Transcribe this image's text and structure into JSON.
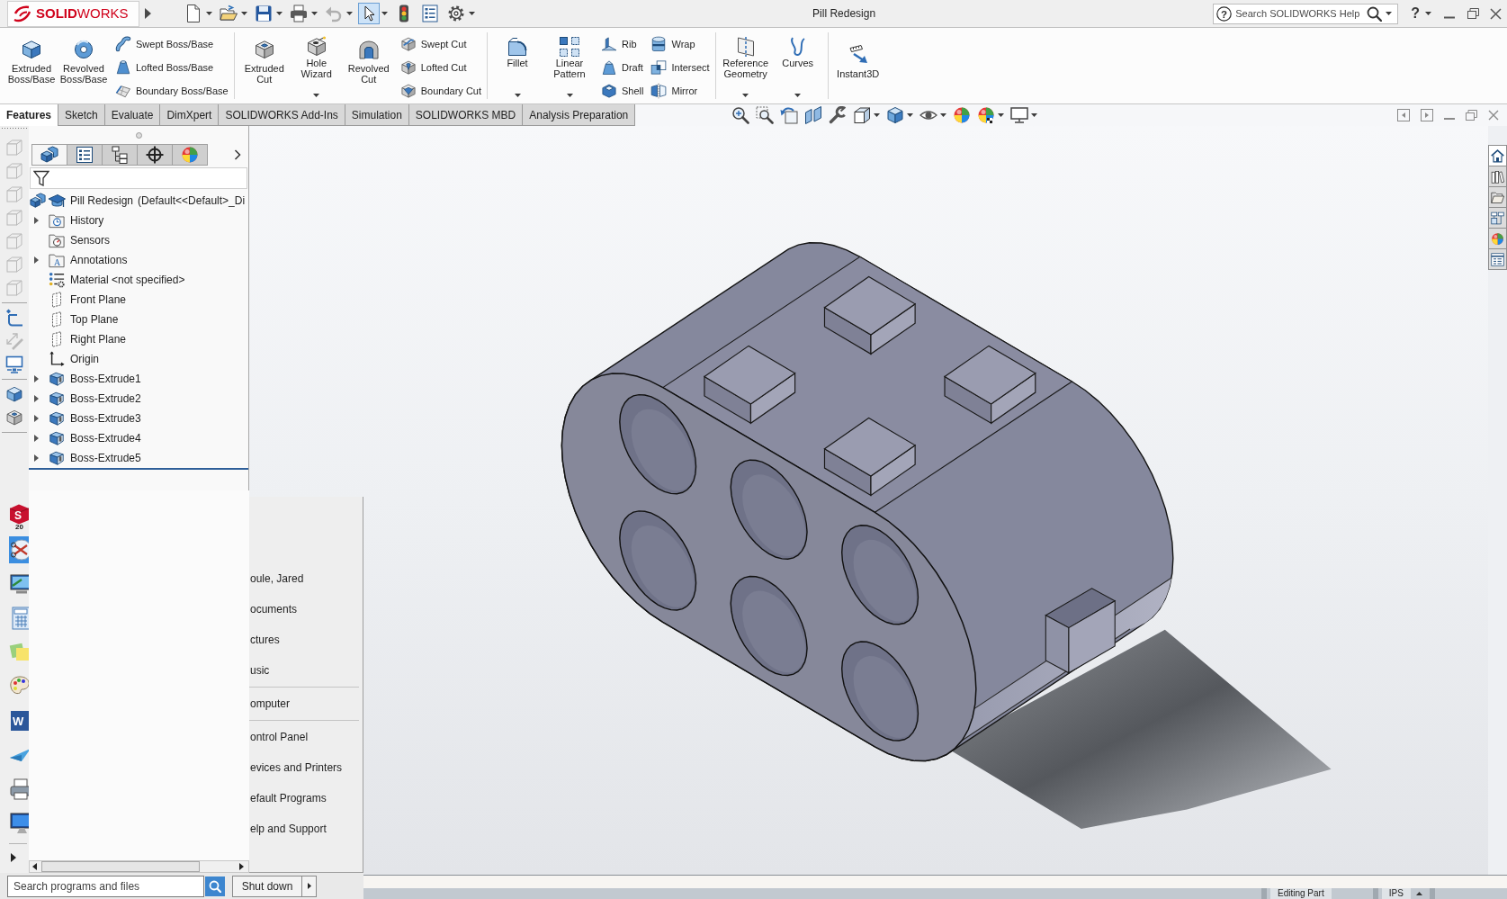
{
  "title_bar": {
    "logo": "**SOLID**WORKS",
    "quick_access": [
      {
        "kind": "new",
        "dropdown": true,
        "disabled": false,
        "pressed": false
      },
      {
        "kind": "open",
        "dropdown": true,
        "disabled": false,
        "pressed": false
      },
      {
        "kind": "save",
        "dropdown": true,
        "disabled": false,
        "pressed": false
      },
      {
        "kind": "print",
        "dropdown": true,
        "disabled": false,
        "pressed": false
      },
      {
        "kind": "undo",
        "dropdown": true,
        "disabled": true,
        "pressed": false
      },
      {
        "kind": "select",
        "dropdown": true,
        "disabled": false,
        "pressed": true
      },
      {
        "kind": "rebuild",
        "dropdown": false,
        "disabled": false,
        "pressed": false
      },
      {
        "kind": "properties",
        "dropdown": false,
        "disabled": false,
        "pressed": false
      },
      {
        "kind": "options",
        "dropdown": true,
        "disabled": false,
        "pressed": false
      }
    ],
    "title": "Pill Redesign",
    "help_search": {
      "glyph": "?",
      "placeholder": "Search SOLIDWORKS Help"
    },
    "help_glyph": "?"
  },
  "ribbon": {
    "groups": [
      {
        "large": [
          {
            "label": "Extruded Boss/Base",
            "kind": "extruded-boss",
            "dropdown": false
          },
          {
            "label": "Revolved Boss/Base",
            "kind": "revolved-boss",
            "dropdown": false
          }
        ],
        "columns": [
          [
            {
              "label": "Swept Boss/Base",
              "kind": "swept-boss"
            },
            {
              "label": "Lofted Boss/Base",
              "kind": "lofted-boss"
            },
            {
              "label": "Boundary Boss/Base",
              "kind": "boundary-boss"
            }
          ]
        ]
      },
      {
        "large": [
          {
            "label": "Extruded Cut",
            "kind": "extruded-cut",
            "dropdown": false
          },
          {
            "label": "Hole Wizard",
            "kind": "hole-wizard",
            "dropdown": true
          },
          {
            "label": "Revolved Cut",
            "kind": "revolved-cut",
            "dropdown": false
          }
        ],
        "columns": [
          [
            {
              "label": "Swept Cut",
              "kind": "swept-cut"
            },
            {
              "label": "Lofted Cut",
              "kind": "lofted-cut"
            },
            {
              "label": "Boundary Cut",
              "kind": "boundary-cut"
            }
          ]
        ]
      },
      {
        "large": [
          {
            "label": "Fillet",
            "kind": "fillet",
            "dropdown": true
          },
          {
            "label": "Linear Pattern",
            "kind": "linear-pattern",
            "dropdown": true
          }
        ],
        "columns": [
          [
            {
              "label": "Rib",
              "kind": "rib"
            },
            {
              "label": "Draft",
              "kind": "draft"
            },
            {
              "label": "Shell",
              "kind": "shell"
            }
          ],
          [
            {
              "label": "Wrap",
              "kind": "wrap"
            },
            {
              "label": "Intersect",
              "kind": "intersect"
            },
            {
              "label": "Mirror",
              "kind": "mirror"
            }
          ]
        ]
      },
      {
        "large": [
          {
            "label": "Reference Geometry",
            "kind": "reference-geometry",
            "dropdown": true
          },
          {
            "label": "Curves",
            "kind": "curves",
            "dropdown": true
          }
        ]
      },
      {
        "large": [
          {
            "label": "Instant3D",
            "kind": "instant3d",
            "dropdown": false
          }
        ]
      }
    ]
  },
  "command_tabs": [
    {
      "label": "Features",
      "selected": true
    },
    {
      "label": "Sketch",
      "selected": false
    },
    {
      "label": "Evaluate",
      "selected": false
    },
    {
      "label": "DimXpert",
      "selected": false
    },
    {
      "label": "SOLIDWORKS Add-Ins",
      "selected": false
    },
    {
      "label": "Simulation",
      "selected": false
    },
    {
      "label": "SOLIDWORKS MBD",
      "selected": false
    },
    {
      "label": "Analysis Preparation",
      "selected": false
    }
  ],
  "heads_up_toolbar": [
    {
      "kind": "zoom-fit",
      "dropdown": false
    },
    {
      "kind": "zoom-area",
      "dropdown": false
    },
    {
      "kind": "previous-view",
      "dropdown": false
    },
    {
      "kind": "section-view",
      "dropdown": false
    },
    {
      "kind": "dynamic-annotation",
      "dropdown": false
    },
    {
      "kind": "view-orientation",
      "dropdown": true
    },
    {
      "kind": "display-style",
      "dropdown": true
    },
    {
      "kind": "hide-show",
      "dropdown": true
    },
    {
      "kind": "edit-appearance",
      "dropdown": false
    },
    {
      "kind": "apply-scene",
      "dropdown": true
    },
    {
      "kind": "view-settings",
      "dropdown": true
    }
  ],
  "side_toolbar": [
    [
      {
        "kind": "view",
        "disabled": true
      },
      {
        "kind": "view",
        "disabled": true
      },
      {
        "kind": "view",
        "disabled": true
      },
      {
        "kind": "view",
        "disabled": true
      },
      {
        "kind": "view",
        "disabled": true
      },
      {
        "kind": "view",
        "disabled": true
      },
      {
        "kind": "view",
        "disabled": true
      }
    ],
    [
      {
        "kind": "sketch",
        "disabled": false
      },
      {
        "kind": "smart-dimension",
        "disabled": true
      },
      {
        "kind": "monitor",
        "disabled": false
      }
    ],
    [
      {
        "kind": "extruded-boss",
        "disabled": false
      },
      {
        "kind": "extruded-cut",
        "disabled": false
      }
    ]
  ],
  "feature_manager": {
    "tabs": [
      {
        "kind": "feature-tree",
        "selected": true
      },
      {
        "kind": "property",
        "selected": false
      },
      {
        "kind": "configuration",
        "selected": false
      },
      {
        "kind": "dimxpert",
        "selected": false
      },
      {
        "kind": "display",
        "selected": false
      }
    ],
    "tree": {
      "name": "Pill Redesign",
      "configuration": "(Default<<Default>_Di",
      "children": [
        {
          "label": "History",
          "kind": "history",
          "expandable": true
        },
        {
          "label": "Sensors",
          "kind": "sensors",
          "expandable": false
        },
        {
          "label": "Annotations",
          "kind": "annotations",
          "glyph": "A",
          "expandable": true
        },
        {
          "label": "Material <not specified>",
          "kind": "material",
          "expandable": false
        },
        {
          "label": "Front Plane",
          "kind": "plane",
          "expandable": false
        },
        {
          "label": "Top Plane",
          "kind": "plane",
          "expandable": false
        },
        {
          "label": "Right Plane",
          "kind": "plane",
          "expandable": false
        },
        {
          "label": "Origin",
          "kind": "origin",
          "expandable": false
        },
        {
          "label": "Boss-Extrude1",
          "kind": "feature",
          "expandable": true
        },
        {
          "label": "Boss-Extrude2",
          "kind": "feature",
          "expandable": true
        },
        {
          "label": "Boss-Extrude3",
          "kind": "feature",
          "expandable": true
        },
        {
          "label": "Boss-Extrude4",
          "kind": "feature",
          "expandable": true
        },
        {
          "label": "Boss-Extrude5",
          "kind": "feature",
          "expandable": true
        }
      ]
    }
  },
  "task_pane": [
    {
      "kind": "home",
      "selected": true
    },
    {
      "kind": "library",
      "selected": false
    },
    {
      "kind": "explorer",
      "selected": false
    },
    {
      "kind": "view-palette",
      "selected": false
    },
    {
      "kind": "appearances",
      "selected": false
    },
    {
      "kind": "custom-properties",
      "selected": false
    }
  ],
  "start_menu": {
    "pinned": [
      {
        "kind": "solidworks",
        "glyph": "S",
        "caption": "20",
        "selected": false
      },
      {
        "kind": "snipping",
        "selected": true
      },
      {
        "kind": "remote-desktop",
        "selected": false
      },
      {
        "kind": "calculator",
        "selected": false
      },
      {
        "kind": "sticky-notes",
        "selected": false
      },
      {
        "kind": "paint",
        "selected": false
      },
      {
        "kind": "word",
        "glyph": "W",
        "selected": false
      },
      {
        "kind": "paper-plane",
        "selected": false
      },
      {
        "kind": "fax",
        "selected": false
      },
      {
        "kind": "monitor",
        "selected": false
      }
    ],
    "places": [
      [
        "oule, Jared",
        "ocuments",
        "ctures",
        "usic"
      ],
      [
        "omputer"
      ],
      [
        "ontrol Panel",
        "evices and Printers",
        "efault Programs",
        "elp and Support"
      ]
    ],
    "search": {
      "placeholder": "Search programs and files"
    },
    "shut_down": "Shut down"
  },
  "status_bar": [
    "Editing Part",
    "IPS"
  ]
}
